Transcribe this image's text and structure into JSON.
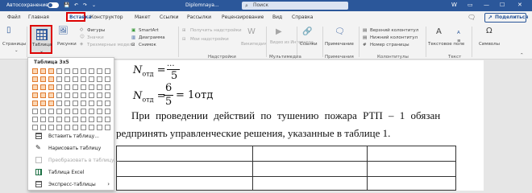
{
  "titlebar": {
    "autosave_label": "Автосохранение",
    "autosave_state": "on",
    "doc_name": "Diplomnaya...",
    "search_placeholder": "Поиск",
    "user_initials": "W"
  },
  "tabs": [
    "Файл",
    "Главная",
    "Вставка",
    "Конструктор",
    "Макет",
    "Ссылки",
    "Рассылки",
    "Рецензирование",
    "Вид",
    "Справка"
  ],
  "active_tab": "Вставка",
  "share_label": "Поделиться",
  "ribbon": {
    "pages": "Страницы",
    "table": "Таблица",
    "pictures": "Рисунки",
    "shapes": "Фигуры",
    "icons": "Значки",
    "models": "Трехмерные модели",
    "smartart": "SmartArt",
    "chart": "Диаграмма",
    "screenshot": "Снимок",
    "get_addins": "Получить надстройки",
    "my_addins": "Мои надстройки",
    "wikipedia": "Википедия",
    "online_video": "Видео из Интернета",
    "links": "Ссылки",
    "comment": "Примечание",
    "header": "Верхний колонтитул",
    "footer": "Нижний колонтитул",
    "page_number": "Номер страницы",
    "textbox": "Текстовое поле",
    "symbols": "Символы",
    "groups": {
      "addins": "Надстройки",
      "media": "Мультимедиа",
      "comments": "Примечания",
      "headers": "Колонтитулы",
      "text": "Текст"
    }
  },
  "dropdown": {
    "title": "Таблица 3x5",
    "grid_cols": 10,
    "grid_rows": 8,
    "selected_cols": 3,
    "selected_rows": 5,
    "items": [
      {
        "label": "Вставить таблицу...",
        "icon": "insert-table-icon",
        "enabled": true
      },
      {
        "label": "Нарисовать таблицу",
        "icon": "draw-table-icon",
        "enabled": true
      },
      {
        "label": "Преобразовать в таблицу...",
        "icon": "convert-table-icon",
        "enabled": false
      },
      {
        "label": "Таблица Excel",
        "icon": "excel-table-icon",
        "enabled": true
      },
      {
        "label": "Экспресс-таблицы",
        "icon": "quick-tables-icon",
        "enabled": true,
        "submenu": true
      }
    ]
  },
  "document": {
    "formula1_lhs": "N",
    "formula1_sub": "отд",
    "formula1_eq": "=",
    "formula1_partial": "...",
    "formula1_den": "5",
    "formula2_lhs": "N",
    "formula2_sub": "отд",
    "formula2_eq": "=",
    "formula2_num": "6",
    "formula2_den": "5",
    "formula2_rhs": "= 1отд",
    "para_line1": "При проведении действий по тушению пожара РТП – 1 обязан",
    "para_line2": "редпринять управленческие решения, указанные в таблице 1."
  }
}
